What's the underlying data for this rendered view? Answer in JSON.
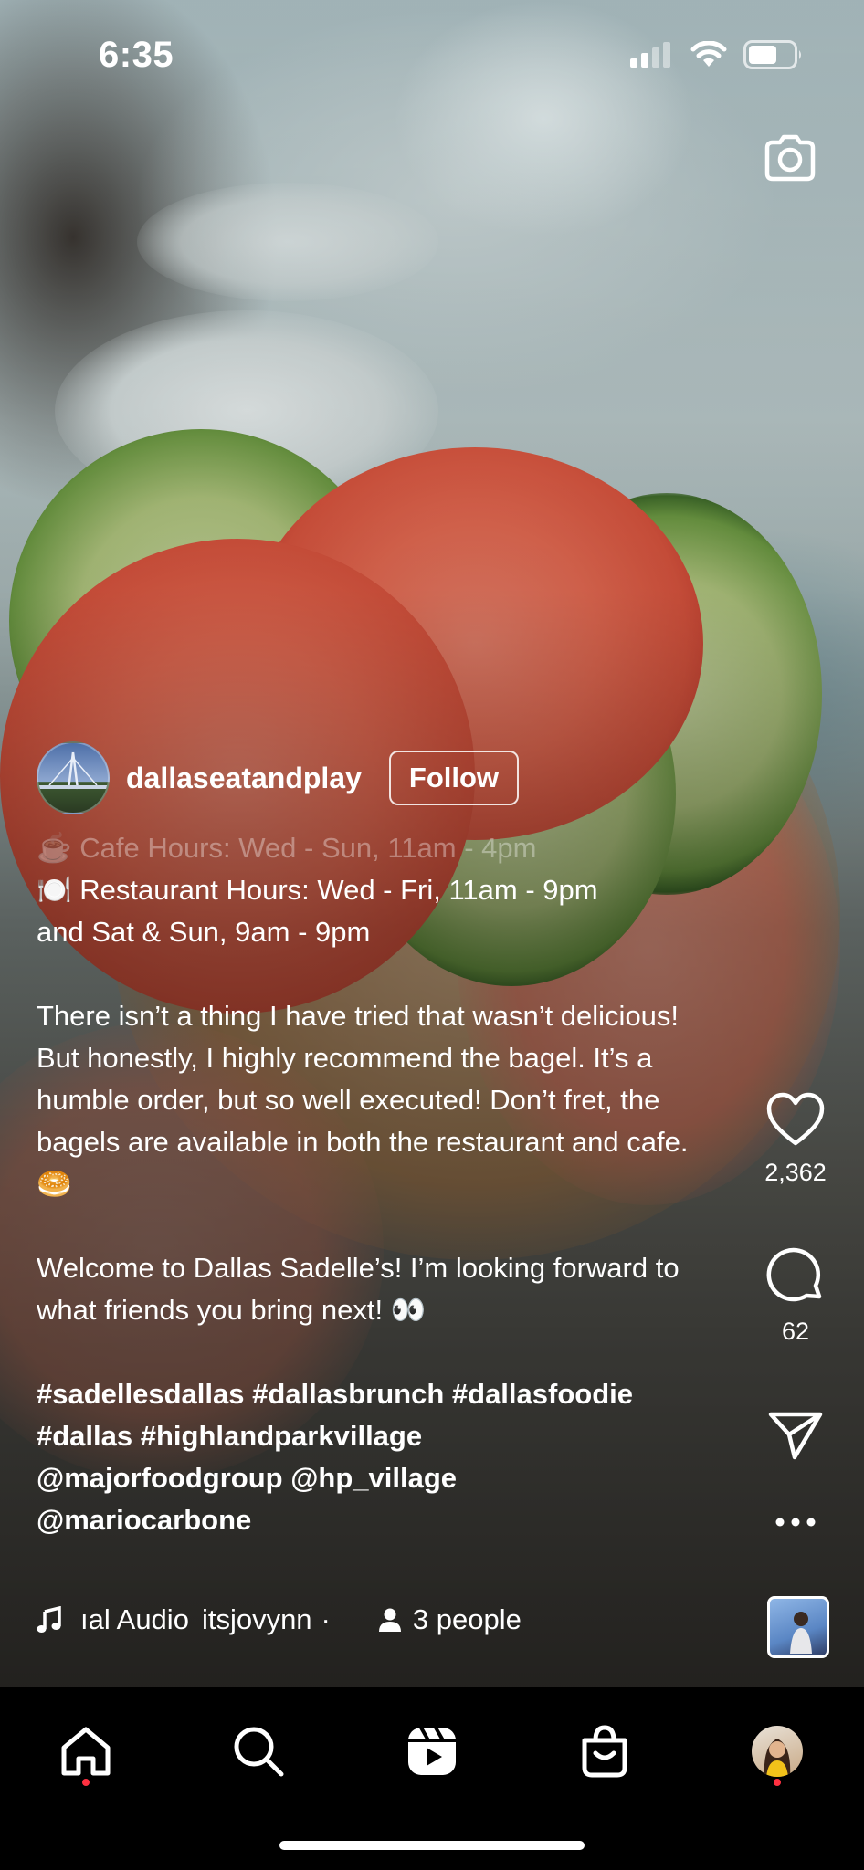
{
  "status_bar": {
    "time": "6:35"
  },
  "post": {
    "username": "dallaseatandplay",
    "follow_label": "Follow",
    "caption": {
      "faded_line": "Cafe Hours: Wed - Sun, 11am - 4pm",
      "line_restaurant": "Restaurant Hours: Wed - Fri, 11am - 9pm",
      "line_restaurant_2": "and Sat & Sun, 9am - 9pm",
      "paragraph_1": "There isn’t a thing I have tried that wasn’t delicious! But honestly, I highly recommend the bagel. It’s a humble order, but so well executed! Don’t fret, the bagels are available in both the restaurant and cafe. 🥯",
      "paragraph_2": "Welcome to Dallas Sadelle’s! I’m looking forward to what friends you bring next! 👀",
      "hashtags_line_1": "#sadellesdallas #dallasbrunch #dallasfoodie",
      "hashtags_line_2": "#dallas #highlandparkvillage",
      "mentions_line_1": "@majorfoodgroup @hp_village",
      "mentions_line_2": "@mariocarbone"
    },
    "audio": {
      "title": "ıal Audio",
      "artist": "itsjovynn",
      "separator": "·",
      "people": "3 people"
    },
    "likes": "2,362",
    "comments": "62"
  },
  "icons": [
    "camera-icon",
    "heart-icon",
    "comment-icon",
    "share-icon",
    "more-icon",
    "music-icon",
    "person-icon",
    "home-icon",
    "search-icon",
    "reels-icon",
    "shop-icon",
    "profile-avatar"
  ],
  "colors": {
    "notification_dot": "#ff3040",
    "nav_background": "#000000"
  }
}
